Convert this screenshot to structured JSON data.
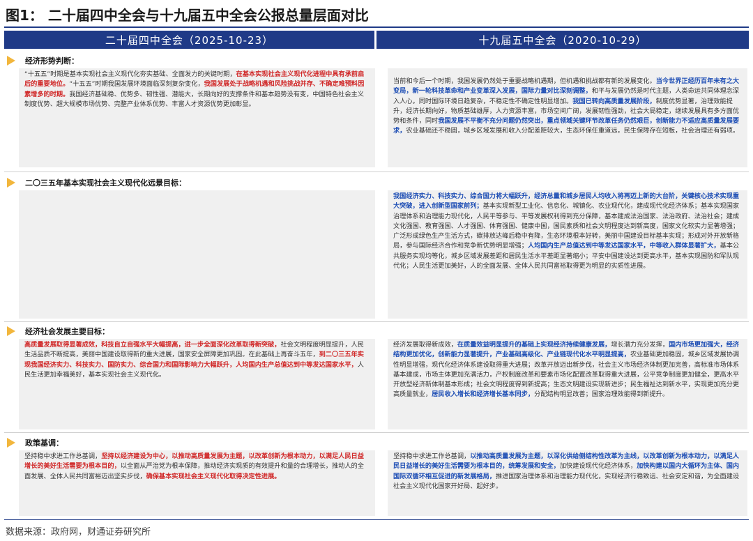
{
  "title": "图1：  二十届四中全会与十九届五中全会公报总量层面对比",
  "columns": {
    "left": "二十届四中全会（2025-10-23）",
    "right": "十九届五中全会（2020-10-29）"
  },
  "sections": {
    "s1": {
      "label": "经济形势判断：",
      "left": [
        {
          "t": "“十五五”时期是基本实现社会主义现代化夯实基础、全面发力的关键时期，",
          "s": ""
        },
        {
          "t": "在基本实现社会主义现代化进程中具有承前启后的重要地位。",
          "s": "r"
        },
        {
          "t": "“十五五”时期我国发展环境面临深刻复杂变化，",
          "s": ""
        },
        {
          "t": "我国发展处于战略机遇和风险挑战并存、不确定难预料因素增多的时期。",
          "s": "r"
        },
        {
          "t": "我国经济基础稳、优势多、韧性强、潜能大，长期向好的支撑条件和基本趋势没有变，中国特色社会主义制度优势、超大规模市场优势、完整产业体系优势、丰富人才资源优势更加彰显。",
          "s": ""
        }
      ],
      "right": [
        {
          "t": "当前和今后一个时期，我国发展仍然处于重要战略机遇期，但机遇和挑战都有新的发展变化。",
          "s": ""
        },
        {
          "t": "当今世界正经历百年未有之大变局，新一轮科技革命和产业变革深入发展，国际力量对比深刻调整，",
          "s": "b"
        },
        {
          "t": "和平与发展仍然是时代主题，人类命运共同体理念深入人心，同时国际环境日趋复杂，不稳定性不确定性明显增加。",
          "s": ""
        },
        {
          "t": "我国已转向高质量发展阶段，",
          "s": "b"
        },
        {
          "t": "制度优势显著，治理效能提升，经济长期向好，物质基础雄厚，人力资源丰富，市场空间广阔，发展韧性强劲，社会大局稳定，继续发展具有多方面优势和条件，同时",
          "s": ""
        },
        {
          "t": "我国发展不平衡不充分问题仍然突出，重点领域关键环节改革任务仍然艰巨，创新能力不适应高质量发展要求，",
          "s": "b"
        },
        {
          "t": "农业基础还不稳固，城乡区域发展和收入分配差距较大，生态环保任重道远，民生保障存在短板，社会治理还有弱项。",
          "s": ""
        }
      ]
    },
    "s2": {
      "label": "二〇三五年基本实现社会主义现代化远景目标：",
      "left": [],
      "right": [
        {
          "t": "我国经济实力、科技实力、综合国力将大幅跃升，经济总量和城乡居民人均收入将再迈上新的大台阶，关键核心技术实现重大突破，进入创新型国家前列；",
          "s": "b"
        },
        {
          "t": "基本实现新型工业化、信息化、城镇化、农业现代化，建成现代化经济体系；基本实现国家治理体系和治理能力现代化，人民平等参与、平等发展权利得到充分保障，基本建成法治国家、法治政府、法治社会；建成文化强国、教育强国、人才强国、体育强国、健康中国，国民素质和社会文明程度达到新高度，国家文化软实力显著增强；广泛形成绿色生产生活方式，碳排放达峰后稳中有降，生态环境根本好转，美丽中国建设目标基本实现；形成对外开放新格局，参与国际经济合作和竞争新优势明显增强；",
          "s": ""
        },
        {
          "t": "人均国内生产总值达到中等发达国家水平，中等收入群体显著扩大，",
          "s": "b"
        },
        {
          "t": "基本公共服务实现均等化，城乡区域发展差距和居民生活水平差距显著缩小；平安中国建设达到更高水平，基本实现国防和军队现代化；人民生活更加美好，人的全面发展、全体人民共同富裕取得更为明显的实质性进展。",
          "s": ""
        }
      ]
    },
    "s3": {
      "label": "经济社会发展主要目标：",
      "left": [
        {
          "t": "高质量发展取得显著成效，科技自立自强水平大幅提高，进一步全面深化改革取得新突破，",
          "s": "r"
        },
        {
          "t": "社会文明程度明显提升，人民生活品质不断提高，美丽中国建设取得新的重大进展，国家安全屏障更加巩固。在此基础上再奋斗五年，",
          "s": ""
        },
        {
          "t": "到二〇三五年实现我国经济实力、科技实力、国防实力、综合国力和国际影响力大幅跃升，人均国内生产总值达到中等发达国家水平，",
          "s": "r"
        },
        {
          "t": "人民生活更加幸福美好，基本实现社会主义现代化。",
          "s": ""
        }
      ],
      "right": [
        {
          "t": "经济发展取得新成效，",
          "s": ""
        },
        {
          "t": "在质量效益明显提升的基础上实现经济持续健康发展，",
          "s": "b"
        },
        {
          "t": "增长潜力充分发挥，",
          "s": ""
        },
        {
          "t": "国内市场更加强大，经济结构更加优化，创新能力显著提升，产业基础高级化、产业链现代化水平明显提高，",
          "s": "b"
        },
        {
          "t": "农业基础更加稳固，城乡区域发展协调性明显增强，现代化经济体系建设取得重大进展；改革开放迈出新步伐，社会主义市场经济体制更加完善，高标准市场体系基本建成，市场主体更加充满活力，产权制度改革和要素市场化配置改革取得重大进展，公平竞争制度更加健全，更高水平开放型经济新体制基本形成；社会文明程度得到新提高；生态文明建设实现新进步；民生福祉达到新水平，实现更加充分更高质量就业，",
          "s": ""
        },
        {
          "t": "居民收入增长和经济增长基本同步，",
          "s": "b"
        },
        {
          "t": "分配结构明显改善；国家治理效能得到新提升。",
          "s": ""
        }
      ]
    },
    "s4": {
      "label": "政策基调：",
      "left": [
        {
          "t": "坚持稳中求进工作总基调，",
          "s": ""
        },
        {
          "t": "坚持以经济建设为中心，以推动高质量发展为主题，以改革创新为根本动力，以满足人民日益增长的美好生活需要为根本目的，",
          "s": "r"
        },
        {
          "t": "以全面从严治党为根本保障，推动经济实现质的有效提升和量的合理增长，推动人的全面发展、全体人民共同富裕迈出坚实步伐，",
          "s": ""
        },
        {
          "t": "确保基本实现社会主义现代化取得决定性进展。",
          "s": "r"
        }
      ],
      "right": [
        {
          "t": "坚持稳中求进工作总基调，",
          "s": ""
        },
        {
          "t": "以推动高质量发展为主题，以深化供给侧结构性改革为主线，以改革创新为根本动力，以满足人民日益增长的美好生活需要为根本目的，统筹发展和安全，",
          "s": "b"
        },
        {
          "t": "加快建设现代化经济体系，",
          "s": ""
        },
        {
          "t": "加快构建以国内大循环为主体、国内国际双循环相互促进的新发展格局，",
          "s": "b"
        },
        {
          "t": "推进国家治理体系和治理能力现代化，实现经济行稳致远、社会安定和谐，为全面建设社会主义现代化国家开好局、起好步。",
          "s": ""
        }
      ]
    }
  },
  "source": "数据来源：政府网，财通证券研究所",
  "colors": {
    "primary": "#1f3a87",
    "accent": "#f2b63c",
    "emphasis_red": "#d12a2a",
    "emphasis_blue": "#1f4fb5",
    "box_bg": "#f0f0f0"
  }
}
